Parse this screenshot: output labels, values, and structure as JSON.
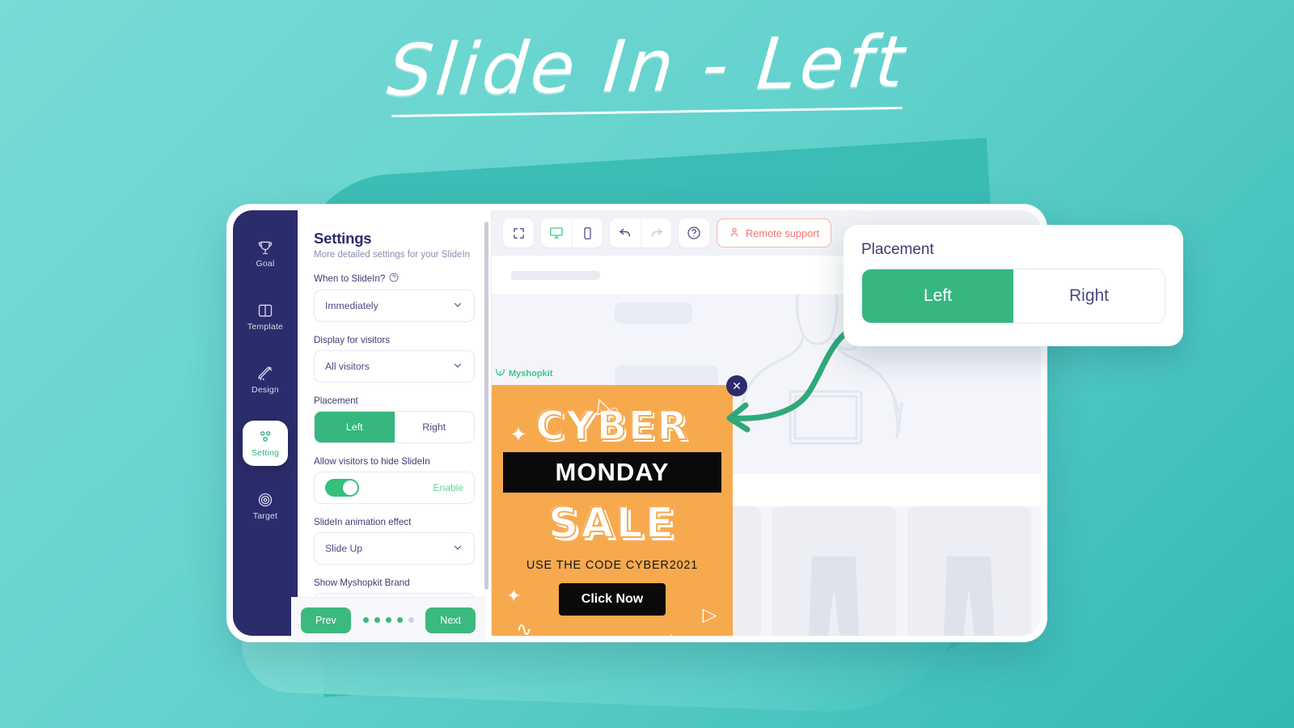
{
  "headline": {
    "text": "Slide In - Left"
  },
  "rail": {
    "items": [
      {
        "label": "Goal",
        "icon": "trophy-icon",
        "active": false
      },
      {
        "label": "Template",
        "icon": "columns-icon",
        "active": false
      },
      {
        "label": "Design",
        "icon": "magic-wand-icon",
        "active": false
      },
      {
        "label": "Setting",
        "icon": "settings-icon",
        "active": true
      },
      {
        "label": "Target",
        "icon": "target-icon",
        "active": false
      }
    ]
  },
  "settings": {
    "title": "Settings",
    "subtitle": "More detailed settings for your SlideIn",
    "when_label": "When to SlideIn?",
    "when_value": "Immediately",
    "display_label": "Display for visitors",
    "display_value": "All visitors",
    "placement_label": "Placement",
    "placement_left": "Left",
    "placement_right": "Right",
    "placement_selected": "Left",
    "hide_label": "Allow visitors to hide SlideIn",
    "hide_state": "Enable",
    "animation_label": "SlideIn animation effect",
    "animation_value": "Slide Up",
    "brand_label": "Show Myshopkit Brand"
  },
  "footer": {
    "prev": "Prev",
    "next": "Next",
    "dots_total": 5,
    "dots_filled": 4
  },
  "toolbar": {
    "fullscreen": "fullscreen-icon",
    "desktop": "desktop-icon",
    "mobile": "mobile-icon",
    "undo": "undo-icon",
    "redo": "redo-icon",
    "help": "help-icon",
    "remote_support": "Remote support"
  },
  "popup": {
    "brand": "Myshopkit",
    "line1": "CYBER",
    "line2": "MONDAY",
    "line3": "SALE",
    "code_text": "USE THE CODE CYBER2021",
    "cta": "Click Now",
    "close": "✕"
  },
  "callout": {
    "label": "Placement",
    "left": "Left",
    "right": "Right",
    "selected": "Left"
  },
  "colors": {
    "background_start": "#79dbd4",
    "background_end": "#33b8b4",
    "rail": "#2b2c6b",
    "accent_green": "#35b77f",
    "popup_orange": "#f7a94e",
    "remote_red": "#f5716f",
    "enable_green": "#6bcf9a"
  }
}
